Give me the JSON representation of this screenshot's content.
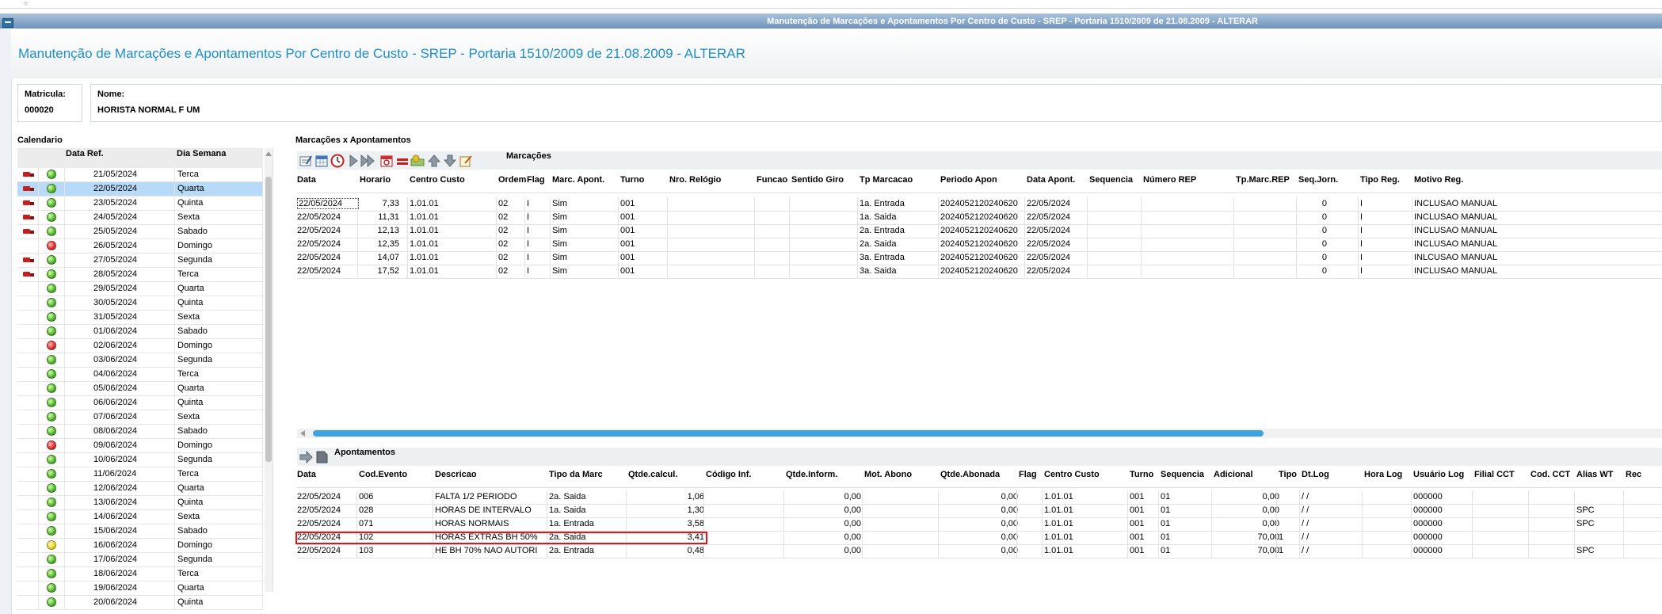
{
  "window": {
    "title": "Manutenção de Marcações e Apontamentos Por Centro de Custo - SREP - Portaria 1510/2009 de 21.08.2009 - ALTERAR"
  },
  "page": {
    "title": "Manutenção de Marcações e Apontamentos Por Centro de Custo - SREP - Portaria 1510/2009 de 21.08.2009 - ALTERAR"
  },
  "employee": {
    "matricula_label": "Matricula:",
    "matricula": "000020",
    "nome_label": "Nome:",
    "nome": "HORISTA NORMAL F UM"
  },
  "calendar": {
    "title": "Calendario",
    "columns": [
      "Data Ref.",
      "Dia Semana"
    ],
    "rows": [
      {
        "flag": "truck",
        "status": "green",
        "date": "21/05/2024",
        "day": "Terca"
      },
      {
        "flag": "truck",
        "status": "green",
        "date": "22/05/2024",
        "day": "Quarta",
        "selected": true
      },
      {
        "flag": "truck",
        "status": "green",
        "date": "23/05/2024",
        "day": "Quinta"
      },
      {
        "flag": "truck",
        "status": "green",
        "date": "24/05/2024",
        "day": "Sexta"
      },
      {
        "flag": "truck",
        "status": "green",
        "date": "25/05/2024",
        "day": "Sabado"
      },
      {
        "flag": "",
        "status": "red",
        "date": "26/05/2024",
        "day": "Domingo"
      },
      {
        "flag": "truck",
        "status": "green",
        "date": "27/05/2024",
        "day": "Segunda"
      },
      {
        "flag": "truck",
        "status": "green",
        "date": "28/05/2024",
        "day": "Terca"
      },
      {
        "flag": "",
        "status": "green",
        "date": "29/05/2024",
        "day": "Quarta"
      },
      {
        "flag": "",
        "status": "green",
        "date": "30/05/2024",
        "day": "Quinta"
      },
      {
        "flag": "",
        "status": "green",
        "date": "31/05/2024",
        "day": "Sexta"
      },
      {
        "flag": "",
        "status": "green",
        "date": "01/06/2024",
        "day": "Sabado"
      },
      {
        "flag": "",
        "status": "red",
        "date": "02/06/2024",
        "day": "Domingo"
      },
      {
        "flag": "",
        "status": "green",
        "date": "03/06/2024",
        "day": "Segunda"
      },
      {
        "flag": "",
        "status": "green",
        "date": "04/06/2024",
        "day": "Terca"
      },
      {
        "flag": "",
        "status": "green",
        "date": "05/06/2024",
        "day": "Quarta"
      },
      {
        "flag": "",
        "status": "green",
        "date": "06/06/2024",
        "day": "Quinta"
      },
      {
        "flag": "",
        "status": "green",
        "date": "07/06/2024",
        "day": "Sexta"
      },
      {
        "flag": "",
        "status": "green",
        "date": "08/06/2024",
        "day": "Sabado"
      },
      {
        "flag": "",
        "status": "red",
        "date": "09/06/2024",
        "day": "Domingo"
      },
      {
        "flag": "",
        "status": "green",
        "date": "10/06/2024",
        "day": "Segunda"
      },
      {
        "flag": "",
        "status": "green",
        "date": "11/06/2024",
        "day": "Terca"
      },
      {
        "flag": "",
        "status": "green",
        "date": "12/06/2024",
        "day": "Quarta"
      },
      {
        "flag": "",
        "status": "green",
        "date": "13/06/2024",
        "day": "Quinta"
      },
      {
        "flag": "",
        "status": "green",
        "date": "14/06/2024",
        "day": "Sexta"
      },
      {
        "flag": "",
        "status": "green",
        "date": "15/06/2024",
        "day": "Sabado"
      },
      {
        "flag": "",
        "status": "yellow",
        "date": "16/06/2024",
        "day": "Domingo"
      },
      {
        "flag": "",
        "status": "green",
        "date": "17/06/2024",
        "day": "Segunda"
      },
      {
        "flag": "",
        "status": "green",
        "date": "18/06/2024",
        "day": "Terca"
      },
      {
        "flag": "",
        "status": "green",
        "date": "19/06/2024",
        "day": "Quarta"
      },
      {
        "flag": "",
        "status": "green",
        "date": "20/06/2024",
        "day": "Quinta"
      }
    ]
  },
  "marcacoes": {
    "section_title": "Marcações x Apontamentos",
    "toolbar_label": "Marcações",
    "columns": [
      "Data",
      "Horario",
      "Centro Custo",
      "Ordem",
      "Flag",
      "Marc. Apont.",
      "Turno",
      "Nro. Relógio",
      "Funcao",
      "Sentido Giro",
      "Tp Marcacao",
      "Periodo Apon",
      "Data Apont.",
      "Sequencia",
      "Número REP",
      "Tp.Marc.REP",
      "Seq.Jorn.",
      "Tipo Reg.",
      "Motivo Reg."
    ],
    "rows": [
      [
        "22/05/2024",
        "7,33",
        "1.01.01",
        "02",
        "I",
        "Sim",
        "001",
        "",
        "",
        "",
        "1a. Entrada",
        "2024052120240620",
        "22/05/2024",
        "",
        "",
        "",
        "0",
        "I",
        "INCLUSAO MANUAL"
      ],
      [
        "22/05/2024",
        "11,31",
        "1.01.01",
        "02",
        "I",
        "Sim",
        "001",
        "",
        "",
        "",
        "1a. Saida",
        "2024052120240620",
        "22/05/2024",
        "",
        "",
        "",
        "0",
        "I",
        "INCLUSAO MANUAL"
      ],
      [
        "22/05/2024",
        "12,13",
        "1.01.01",
        "02",
        "I",
        "Sim",
        "001",
        "",
        "",
        "",
        "2a. Entrada",
        "2024052120240620",
        "22/05/2024",
        "",
        "",
        "",
        "0",
        "I",
        "INCLUSAO MANUAL"
      ],
      [
        "22/05/2024",
        "12,35",
        "1.01.01",
        "02",
        "I",
        "Sim",
        "001",
        "",
        "",
        "",
        "2a. Saida",
        "2024052120240620",
        "22/05/2024",
        "",
        "",
        "",
        "0",
        "I",
        "INCLUSAO MANUAL"
      ],
      [
        "22/05/2024",
        "14,07",
        "1.01.01",
        "02",
        "I",
        "Sim",
        "001",
        "",
        "",
        "",
        "3a. Entrada",
        "2024052120240620",
        "22/05/2024",
        "",
        "",
        "",
        "0",
        "I",
        "INLCUSAO MANUAL"
      ],
      [
        "22/05/2024",
        "17,52",
        "1.01.01",
        "02",
        "I",
        "Sim",
        "001",
        "",
        "",
        "",
        "3a. Saida",
        "2024052120240620",
        "22/05/2024",
        "",
        "",
        "",
        "0",
        "I",
        "INCLUSAO MANUAL"
      ]
    ]
  },
  "apontamentos": {
    "toolbar_label": "Apontamentos",
    "columns": [
      "Data",
      "Cod.Evento",
      "Descricao",
      "Tipo da Marc",
      "Qtde.calcul.",
      "Código Inf.",
      "Qtde.Inform.",
      "Mot. Abono",
      "Qtde.Abonada",
      "Flag",
      "Centro Custo",
      "Turno",
      "Sequencia",
      "Adicional",
      "Tipo",
      "Dt.Log",
      "Hora Log",
      "Usuário Log",
      "Filial CCT",
      "Cod. CCT",
      "Alias WT",
      "Rec"
    ],
    "rows": [
      [
        "22/05/2024",
        "006",
        "FALTA 1/2 PERIODO",
        "2a. Saida",
        "1,06",
        "",
        "0,00",
        "",
        "0,00",
        "",
        "1.01.01",
        "001",
        "01",
        "0,00",
        "",
        "/ /",
        "",
        "000000",
        "",
        "",
        "",
        ""
      ],
      [
        "22/05/2024",
        "028",
        "HORAS DE INTERVALO",
        "1a. Saida",
        "1,30",
        "",
        "0,00",
        "",
        "0,00",
        "",
        "1.01.01",
        "001",
        "01",
        "0,00",
        "",
        "/ /",
        "",
        "000000",
        "",
        "",
        "SPC",
        ""
      ],
      [
        "22/05/2024",
        "071",
        "HORAS NORMAIS",
        "1a. Entrada",
        "3,58",
        "",
        "0,00",
        "",
        "0,00",
        "",
        "1.01.01",
        "001",
        "01",
        "0,00",
        "",
        "/ /",
        "",
        "000000",
        "",
        "",
        "SPC",
        ""
      ],
      [
        "22/05/2024",
        "102",
        "HORAS EXTRAS BH 50%",
        "2a. Saida",
        "3,41",
        "",
        "0,00",
        "",
        "0,00",
        "",
        "1.01.01",
        "001",
        "01",
        "70,00",
        "1",
        "/ /",
        "",
        "000000",
        "",
        "",
        "",
        ""
      ],
      [
        "22/05/2024",
        "103",
        "HE BH 70% NAO AUTORI",
        "2a. Entrada",
        "0,48",
        "",
        "0,00",
        "",
        "0,00",
        "",
        "1.01.01",
        "001",
        "01",
        "70,00",
        "1",
        "/ /",
        "",
        "000000",
        "",
        "",
        "SPC",
        ""
      ]
    ]
  }
}
